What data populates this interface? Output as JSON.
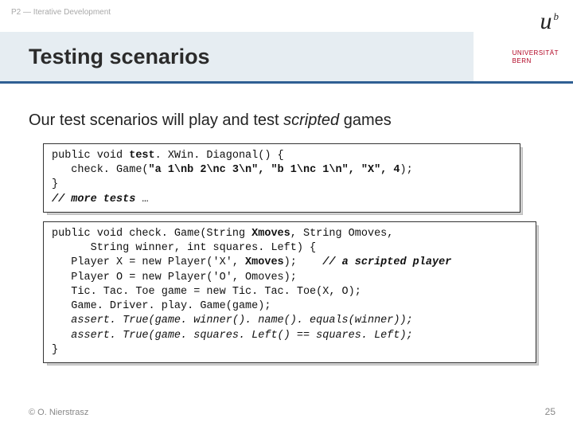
{
  "breadcrumb": "P2 — Iterative Development",
  "title": "Testing scenarios",
  "logo": {
    "u": "u",
    "sup": "b",
    "line1": "UNIVERSITÄT",
    "line2": "BERN"
  },
  "intro": {
    "pre": "Our test scenarios will play and test ",
    "em": "scripted",
    "post": " games"
  },
  "code1": {
    "l1a": "public void ",
    "l1b": "test",
    "l1c": ". XWin. Diagonal() {",
    "l2a": "   check. Game(",
    "l2b": "\"a 1\\nb 2\\nc 3\\n\", \"b 1\\nc 1\\n\", \"X\", 4",
    "l2c": ");",
    "l3": "}",
    "l4a": "// more tests ",
    "l4b": "…"
  },
  "code2": {
    "l1a": "public void check. Game(String ",
    "l1b": "Xmoves",
    "l1c": ", String Omoves,",
    "l2": "      String winner, int squares. Left) {",
    "l3a": "   Player X = new Player('X', ",
    "l3b": "Xmoves",
    "l3c": ");    ",
    "l3d": "// a scripted player",
    "l4": "   Player O = new Player('O', Omoves);",
    "l5": "   Tic. Tac. Toe game = new Tic. Tac. Toe(X, O);",
    "l6": "   Game. Driver. play. Game(game);",
    "l7": "   assert. True(game. winner(). name(). equals(winner));",
    "l8": "   assert. True(game. squares. Left() == squares. Left);",
    "l9": "}"
  },
  "footer": {
    "left": "© O. Nierstrasz",
    "right": "25"
  }
}
